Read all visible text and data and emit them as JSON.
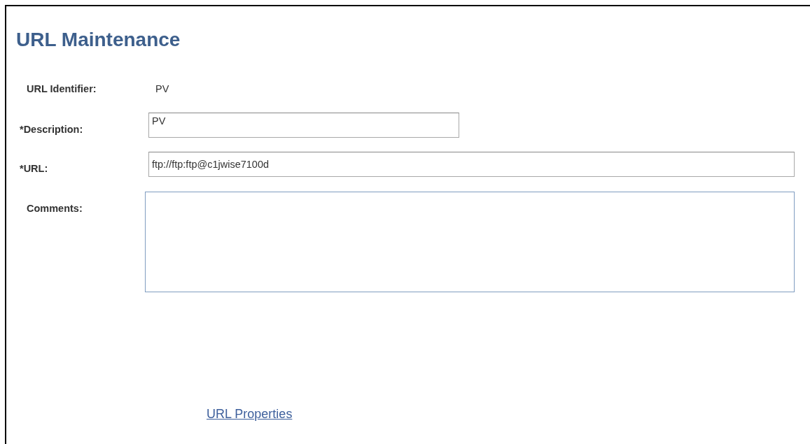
{
  "title": "URL Maintenance",
  "fields": [
    {
      "kind": "display",
      "label": "URL Identifier:",
      "value": "PV"
    },
    {
      "kind": "input",
      "label": "*Description:",
      "value": "PV"
    },
    {
      "kind": "input",
      "label": "*URL:",
      "value": "ftp://ftp:ftp@c1jwise7100d"
    },
    {
      "kind": "textarea",
      "label": "Comments:"
    }
  ],
  "link": "URL Properties"
}
